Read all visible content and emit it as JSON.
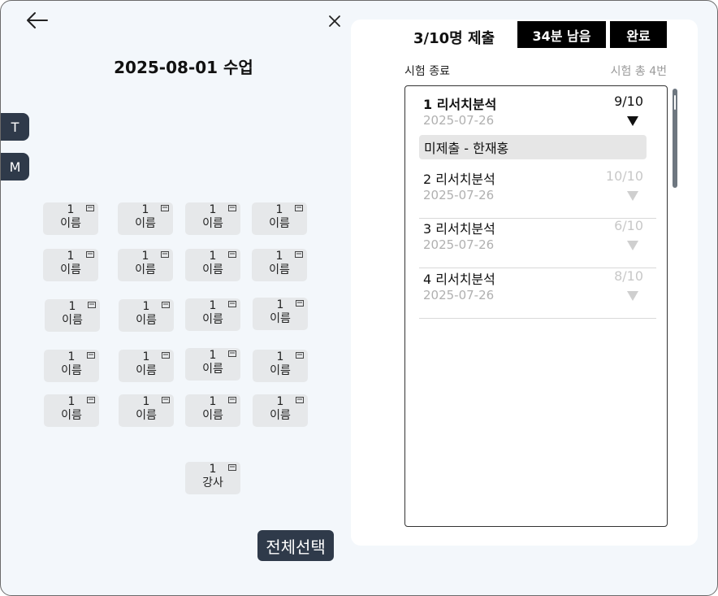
{
  "header": {
    "title": "2025-08-01 수업"
  },
  "side_tabs": [
    "T",
    "M"
  ],
  "seats": [
    {
      "num": "1",
      "label": "이름"
    },
    {
      "num": "1",
      "label": "이름"
    },
    {
      "num": "1",
      "label": "이름"
    },
    {
      "num": "1",
      "label": "이름"
    },
    {
      "num": "1",
      "label": "이름"
    },
    {
      "num": "1",
      "label": "이름"
    },
    {
      "num": "1",
      "label": "이름"
    },
    {
      "num": "1",
      "label": "이름"
    },
    {
      "num": "1",
      "label": "이름"
    },
    {
      "num": "1",
      "label": "이름"
    },
    {
      "num": "1",
      "label": "이름"
    },
    {
      "num": "1",
      "label": "이름"
    },
    {
      "num": "1",
      "label": "이름"
    },
    {
      "num": "1",
      "label": "이름"
    },
    {
      "num": "1",
      "label": "이름"
    },
    {
      "num": "1",
      "label": "이름"
    },
    {
      "num": "1",
      "label": "이름"
    },
    {
      "num": "1",
      "label": "이름"
    },
    {
      "num": "1",
      "label": "이름"
    },
    {
      "num": "1",
      "label": "이름"
    }
  ],
  "teacher_seat": {
    "num": "1",
    "label": "강사"
  },
  "select_all_label": "전체선택",
  "panel": {
    "submit_count": "3/10명 제출",
    "time_left": "34분 남음",
    "done_label": "완료",
    "exam_end_label": "시험 종료",
    "exam_total": "시험 총 4번",
    "exams": [
      {
        "title": "1 리서치분석",
        "date": "2025-07-26",
        "score": "9/10",
        "expanded": true
      },
      {
        "title": "2 리서치분석",
        "date": "2025-07-26",
        "score": "10/10",
        "expanded": false
      },
      {
        "title": "3 리서치분석",
        "date": "2025-07-26",
        "score": "6/10",
        "expanded": false
      },
      {
        "title": "4 리서치분석",
        "date": "2025-07-26",
        "score": "8/10",
        "expanded": false
      }
    ],
    "not_submitted": "미제출 - 한재홍"
  }
}
